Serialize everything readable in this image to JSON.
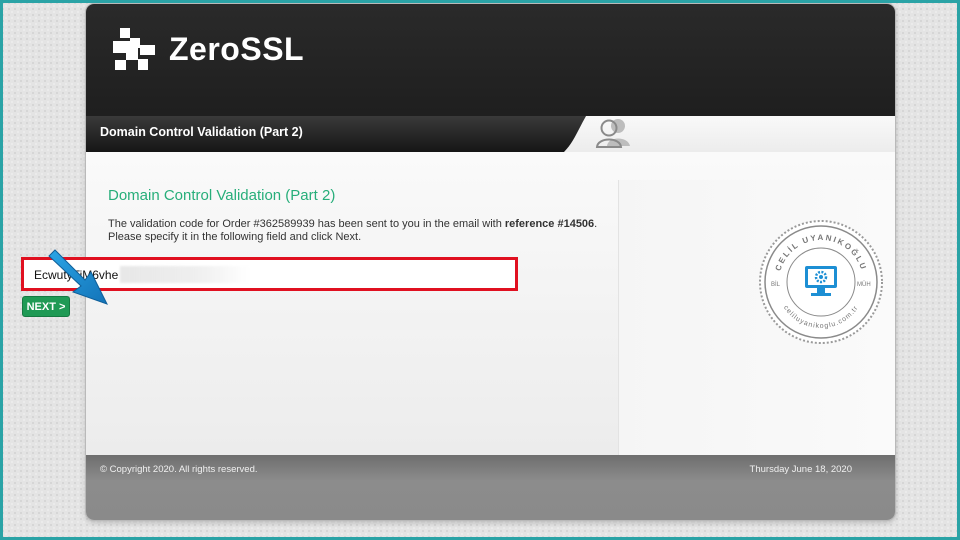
{
  "brand": {
    "name": "ZeroSSL"
  },
  "subbar": {
    "title": "Domain Control Validation (Part 2)"
  },
  "content": {
    "title": "Domain Control Validation (Part 2)",
    "line1_prefix": "The validation code for Order #362589939 has been sent to you in the email with ",
    "reference_label": "reference #14506",
    "line1_suffix": ".",
    "line2": "Please specify it in the following field and click Next."
  },
  "form": {
    "code_value": "EcwutyTiM6vhe",
    "next_label": "NEXT >"
  },
  "watermark": {
    "top_text": "CELİL UYANIKOĞLU",
    "left_text": "BİL",
    "right_text": "MÜH",
    "bottom_text": "celiluyanikoglu.com.tr"
  },
  "footer": {
    "copyright": "© Copyright 2020. All rights reserved.",
    "date": "Thursday June 18, 2020"
  },
  "colors": {
    "accent_green": "#27ae7a",
    "button_green": "#1f9a55",
    "highlight_red": "#e01020",
    "arrow_blue": "#1e8fd0",
    "frame_teal": "#2aa3a6"
  },
  "icons": {
    "logo": "zerossl-logo-icon",
    "user": "users-icon",
    "arrow": "pointer-arrow-icon"
  }
}
